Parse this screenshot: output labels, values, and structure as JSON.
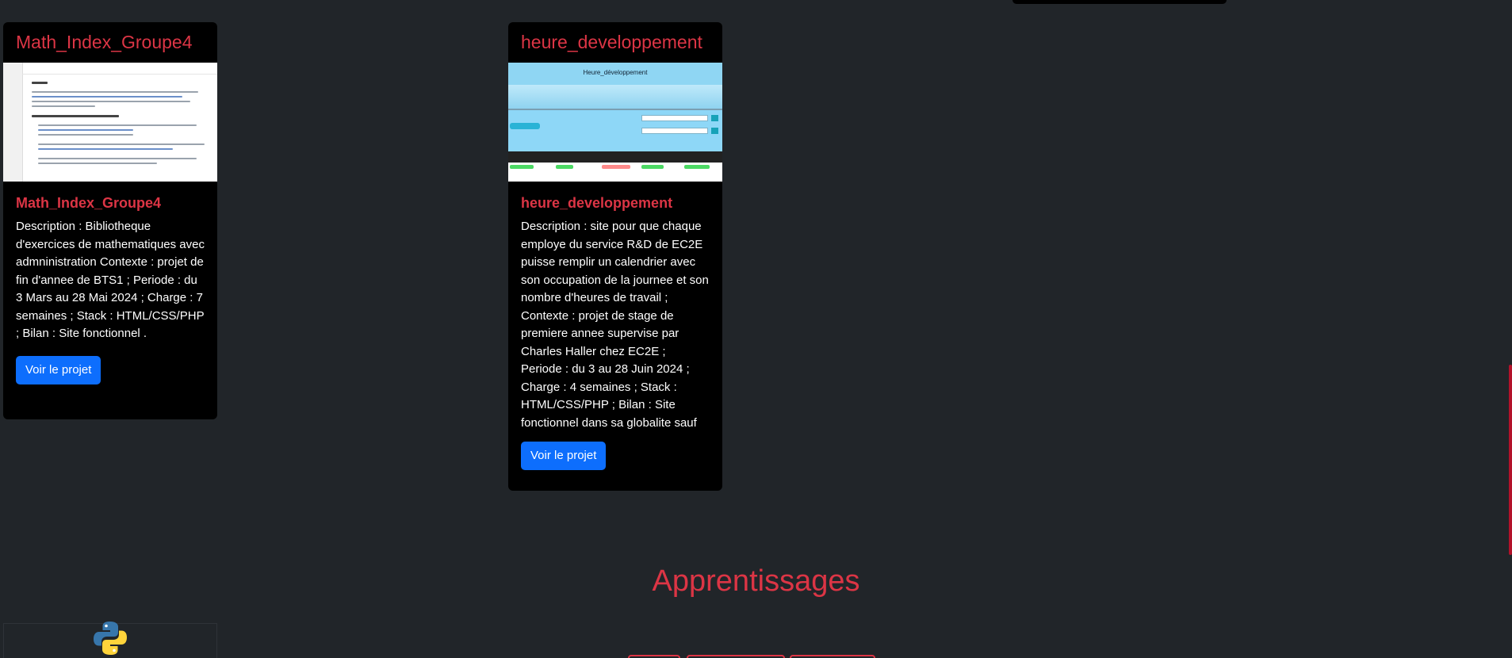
{
  "colors": {
    "background": "#212529",
    "card": "#000000",
    "accent": "#dc3545",
    "button": "#0d6efd"
  },
  "projects": [
    {
      "header": "Math_Index_Groupe4",
      "title": "Math_Index_Groupe4",
      "description": "Description : Bibliotheque d'exercices de mathematiques avec admninistration Contexte : projet de fin d'annee de BTS1 ; Periode : du 3 Mars au 28 Mai 2024 ; Charge : 7 semaines ; Stack : HTML/CSS/PHP ; Bilan : Site fonctionnel .",
      "button": "Voir le projet"
    },
    {
      "header": "heure_developpement",
      "title": "heure_developpement",
      "thumbnail_title": "Heure_développement",
      "description": "Description : site pour que chaque employe du service R&D de EC2E puisse remplir un calendrier avec son occupation de la journee et son nombre d'heures de travail ; Contexte : projet de stage de premiere annee supervise par Charles Haller chez EC2E ; Periode : du 3 au 28 Juin 2024 ; Charge : 4 semaines ; Stack : HTML/CSS/PHP ; Bilan : Site fonctionnel dans sa globalite sauf pour la recherche d",
      "button": "Voir le projet"
    }
  ],
  "section": {
    "title": "Apprentissages"
  },
  "icons": {
    "skill": "python-icon"
  }
}
